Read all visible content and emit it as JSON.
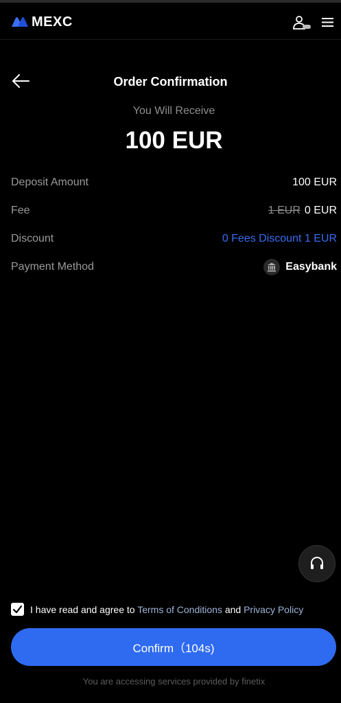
{
  "header": {
    "brand": "MEXC",
    "user_icon": "user-icon",
    "menu_icon": "menu-icon"
  },
  "page": {
    "title": "Order Confirmation",
    "back_icon": "arrow-left-icon"
  },
  "summary": {
    "receive_label": "You Will Receive",
    "receive_amount": "100 EUR"
  },
  "details": {
    "deposit_label": "Deposit Amount",
    "deposit_value": "100 EUR",
    "fee_label": "Fee",
    "fee_original": "1 EUR",
    "fee_value": "0 EUR",
    "discount_label": "Discount",
    "discount_value": "0 Fees Discount 1 EUR",
    "payment_label": "Payment Method",
    "payment_value": "Easybank",
    "payment_icon": "bank-icon"
  },
  "support": {
    "icon": "headset-icon"
  },
  "agreement": {
    "checked": true,
    "text_prefix": "I have read and agree to",
    "terms_link": "Terms of Conditions",
    "and": "and",
    "privacy_link": "Privacy Policy"
  },
  "confirm_button": {
    "label": "Confirm（104s)"
  },
  "footer": {
    "text": "You are accessing services provided by finetix"
  },
  "colors": {
    "background": "#000000",
    "accent": "#2f6bf1",
    "discount": "#3a6cf4",
    "brand_logo": "#3b6ef5"
  }
}
